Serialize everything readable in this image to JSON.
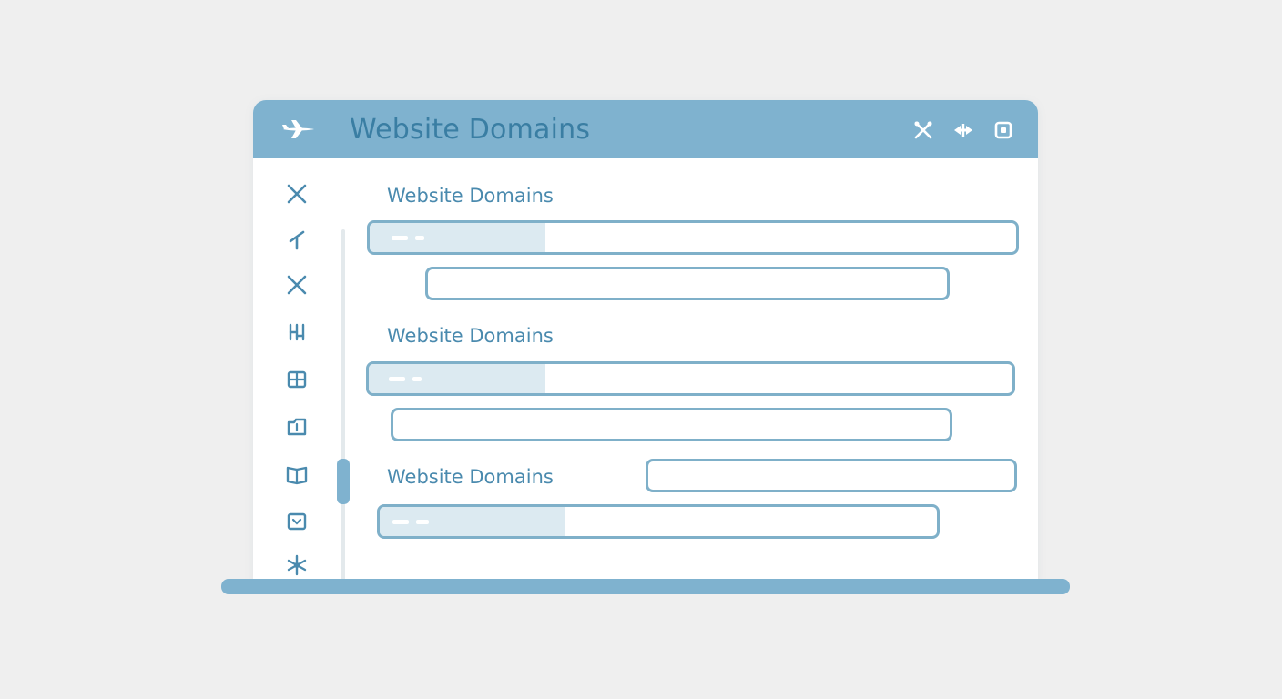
{
  "window": {
    "title": "Website Domains"
  },
  "titlebar": {
    "icons": [
      "airplane-icon",
      "tools-icon",
      "arrows-icon",
      "square-icon"
    ]
  },
  "sidebar": {
    "icons": [
      "close-icon",
      "edit-icon",
      "close-icon",
      "columns-icon",
      "grid-icon",
      "folder-icon",
      "book-icon",
      "box-icon",
      "asterisk-icon"
    ]
  },
  "sections": [
    {
      "label": "Website Domains"
    },
    {
      "label": "Website Domains"
    },
    {
      "label": "Website Domains"
    }
  ],
  "colors": {
    "accent": "#7fb2cf",
    "title_text": "#3a7ea3",
    "label_text": "#4a8aae",
    "field_border": "#7fb0c9",
    "field_fill": "#dceaf1",
    "background": "#efefef"
  }
}
